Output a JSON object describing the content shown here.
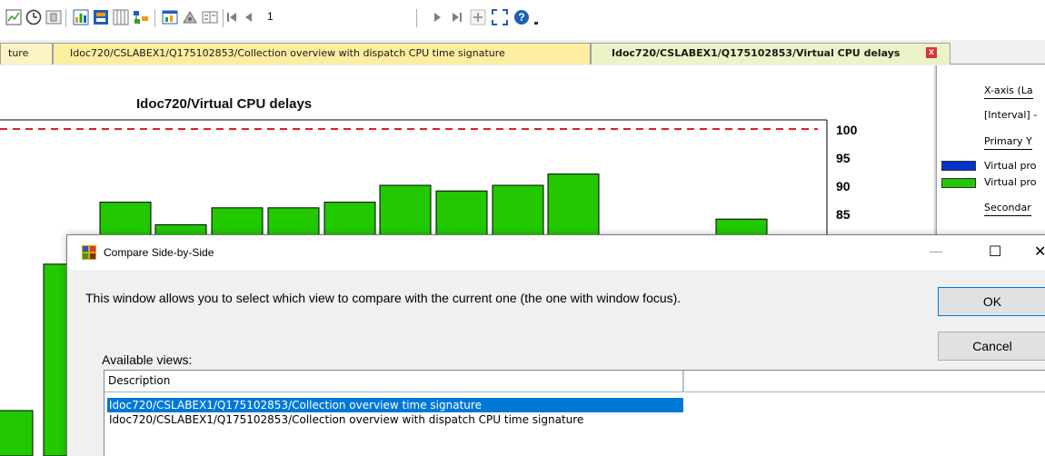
{
  "toolbar": {
    "page_number": "1",
    "icons": [
      "line-chart-icon",
      "clock-icon",
      "panel-icon",
      "bar-chart-icon",
      "bar-chart-2-icon",
      "grid-icon",
      "flowchart-icon",
      "chart-window-icon",
      "tools-icon",
      "compare-icon",
      "first-page-icon",
      "prev-page-icon",
      "next-page-icon",
      "last-page-icon",
      "add-icon",
      "fullscreen-icon",
      "help-icon",
      "dropdown-icon"
    ],
    "colors": {
      "green": "#2fa01e",
      "blue": "#1f5fb8",
      "gray": "#808080"
    }
  },
  "tabs": [
    {
      "label": "ture"
    },
    {
      "label": "Idoc720/CSLABEX1/Q175102853/Collection overview with dispatch CPU time signature"
    },
    {
      "label": "Idoc720/CSLABEX1/Q175102853/Virtual CPU delays",
      "active": true
    }
  ],
  "tab_close_glyph": "x",
  "chart_data": {
    "type": "bar",
    "title": "Idoc720/Virtual CPU delays",
    "ylim": [
      0,
      100
    ],
    "y_ticks": [
      "100",
      "95",
      "90",
      "85"
    ],
    "series": [
      {
        "values": [
          76,
          87,
          83,
          86,
          86,
          87,
          90,
          89,
          90,
          92,
          81,
          80,
          84
        ]
      }
    ],
    "threshold": 100,
    "colors": {
      "bar": "#22c800",
      "threshold": "#e02020"
    }
  },
  "legend": {
    "xaxis_label": "X-axis (La",
    "interval_label": "[Interval] -",
    "primary_label": "Primary Y",
    "series": [
      {
        "label": "Virtual pro",
        "color": "#0033cc"
      },
      {
        "label": "Virtual pro",
        "color": "#22c800"
      }
    ],
    "secondary_label": "Secondar"
  },
  "dialog": {
    "title": "Compare Side-by-Side",
    "minimize": "—",
    "maximize": "☐",
    "close": "✕",
    "message": "This window allows you to select which view to compare with the current one (the one with window focus).",
    "ok_label": "OK",
    "cancel_label": "Cancel",
    "available_label": "Available views:",
    "column_header": "Description",
    "rows": [
      {
        "label": "Idoc720/CSLABEX1/Q175102853/Collection overview time signature",
        "selected": true
      },
      {
        "label": "Idoc720/CSLABEX1/Q175102853/Collection overview with dispatch CPU time signature",
        "selected": false
      }
    ]
  }
}
